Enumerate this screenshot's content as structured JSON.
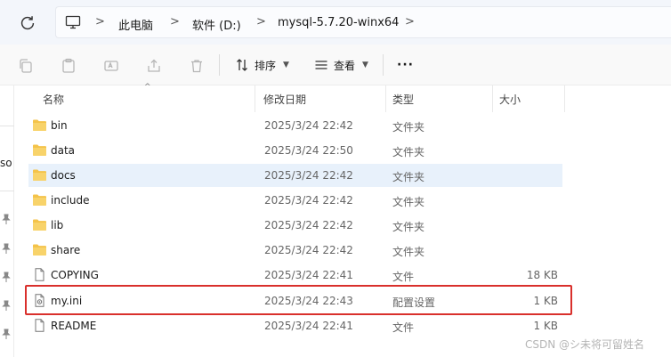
{
  "address_bar": {
    "crumbs": [
      "此电脑",
      "软件 (D:)",
      "mysql-5.7.20-winx64"
    ],
    "separator": ">"
  },
  "toolbar": {
    "sort_label": "排序",
    "view_label": "查看",
    "more_label": "···"
  },
  "left_pane": {
    "partial_text": "so"
  },
  "columns": {
    "name": "名称",
    "modified": "修改日期",
    "type": "类型",
    "size": "大小"
  },
  "files": [
    {
      "name": "bin",
      "modified": "2025/3/24 22:42",
      "type": "文件夹",
      "size": "",
      "icon": "folder-icon"
    },
    {
      "name": "data",
      "modified": "2025/3/24 22:50",
      "type": "文件夹",
      "size": "",
      "icon": "folder-icon"
    },
    {
      "name": "docs",
      "modified": "2025/3/24 22:42",
      "type": "文件夹",
      "size": "",
      "icon": "folder-icon"
    },
    {
      "name": "include",
      "modified": "2025/3/24 22:42",
      "type": "文件夹",
      "size": "",
      "icon": "folder-icon"
    },
    {
      "name": "lib",
      "modified": "2025/3/24 22:42",
      "type": "文件夹",
      "size": "",
      "icon": "folder-icon"
    },
    {
      "name": "share",
      "modified": "2025/3/24 22:42",
      "type": "文件夹",
      "size": "",
      "icon": "folder-icon"
    },
    {
      "name": "COPYING",
      "modified": "2025/3/24 22:41",
      "type": "文件",
      "size": "18 KB",
      "icon": "file-icon"
    },
    {
      "name": "my.ini",
      "modified": "2025/3/24 22:43",
      "type": "配置设置",
      "size": "1 KB",
      "icon": "config-file-icon"
    },
    {
      "name": "README",
      "modified": "2025/3/24 22:41",
      "type": "文件",
      "size": "1 KB",
      "icon": "file-icon"
    }
  ],
  "watermark": "CSDN @シ未将可留姓名",
  "colors": {
    "folder": "#f4c34a",
    "selection": "#e8f1fb",
    "highlight_box": "#d9302c"
  }
}
